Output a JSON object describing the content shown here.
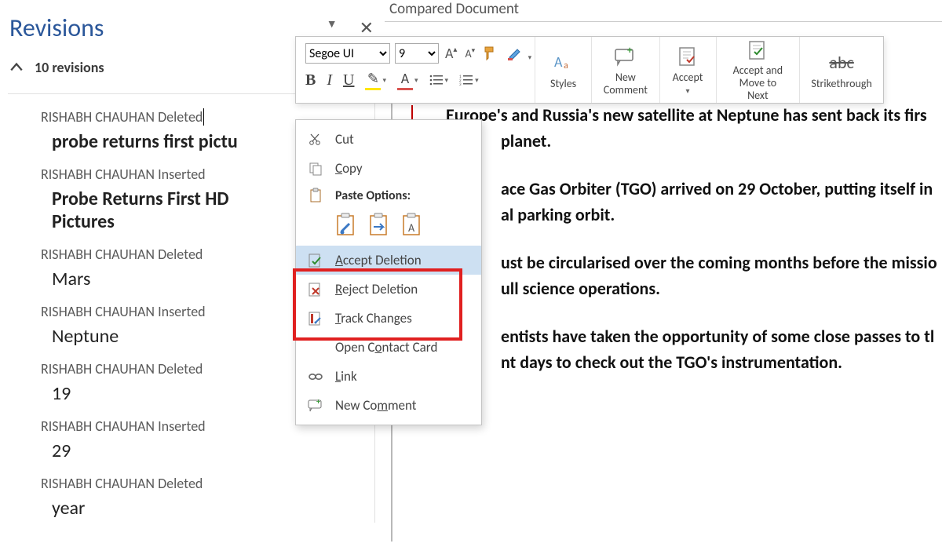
{
  "panel": {
    "title": "Revisions",
    "count_label": "10 revisions"
  },
  "revisions": [
    {
      "meta": "RISHABH CHAUHAN Deleted",
      "text": "probe returns first pictu",
      "bold": true,
      "cursor": true
    },
    {
      "meta": "RISHABH CHAUHAN Inserted",
      "text": "Probe Returns First HD Pictures",
      "bold": true
    },
    {
      "meta": "RISHABH CHAUHAN Deleted",
      "text": "Mars"
    },
    {
      "meta": "RISHABH CHAUHAN Inserted",
      "text": "Neptune"
    },
    {
      "meta": "RISHABH CHAUHAN Deleted",
      "text": "19"
    },
    {
      "meta": "RISHABH CHAUHAN Inserted",
      "text": "29"
    },
    {
      "meta": "RISHABH CHAUHAN Deleted",
      "text": "year"
    }
  ],
  "doc": {
    "tab_title": "Compared Document",
    "paragraphs": [
      "Europe's and Russia's new satellite at Neptune has sent back its firs",
      "planet.",
      "ace Gas Orbiter (TGO) arrived on 29 October, putting itself in",
      "al parking orbit.",
      "ust be circularised over the coming months before the missio",
      "ull science operations.",
      "entists have taken the opportunity of some close passes to tl",
      "nt days to check out the TGO's instrumentation."
    ]
  },
  "mini_toolbar": {
    "font_name": "Segoe UI",
    "font_size": "9",
    "styles_label": "Styles",
    "buttons": {
      "new_comment": "New\nComment",
      "accept": "Accept",
      "accept_move": "Accept and\nMove to Next",
      "strike": "Strikethrough"
    }
  },
  "context_menu": {
    "cut": "Cut",
    "copy": "Copy",
    "paste_label": "Paste Options:",
    "accept_del": "Accept Deletion",
    "reject_del": "Reject Deletion",
    "track": "Track Changes",
    "contact": "Open Contact Card",
    "link": "Link",
    "new_comment": "New Comment"
  }
}
